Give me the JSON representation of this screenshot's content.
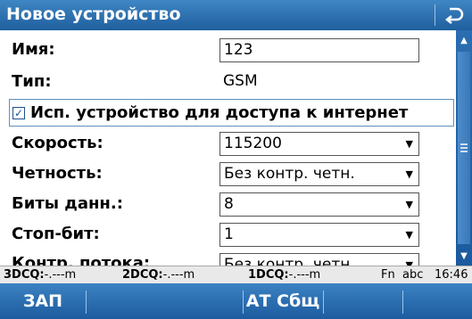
{
  "window": {
    "title": "Новое устройство",
    "back_icon": "return-arrow-icon"
  },
  "form": {
    "name": {
      "label": "Имя:",
      "value": "123"
    },
    "type": {
      "label": "Тип:",
      "value": "GSM"
    },
    "use_internet": {
      "label": "Исп. устройство для доступа к интернет",
      "checked": true
    },
    "speed": {
      "label": "Скорость:",
      "value": "115200"
    },
    "parity": {
      "label": "Четность:",
      "value": "Без контр. четн."
    },
    "data_bits": {
      "label": "Биты данн.:",
      "value": "8"
    },
    "stop_bit": {
      "label": "Стоп-бит:",
      "value": "1"
    },
    "flow_control": {
      "label": "Контр. потока:",
      "value": "Без контр. четн."
    }
  },
  "status": {
    "dcq3": {
      "label": "3DCQ:",
      "value": "-.---m"
    },
    "dcq2": {
      "label": "2DCQ:",
      "value": "-.---m"
    },
    "dcq1": {
      "label": "1DCQ:",
      "value": "-.---m"
    },
    "fn": "Fn",
    "input_mode": "abc",
    "time": "16:46"
  },
  "softkeys": {
    "key1": "ЗАП",
    "key2": "",
    "key3": "АТ Сбщ",
    "key4": ""
  },
  "colors": {
    "titlebar": "#2a6fb2",
    "softkeys": "#2a6fb2",
    "status_bg": "#e9e9e9"
  }
}
